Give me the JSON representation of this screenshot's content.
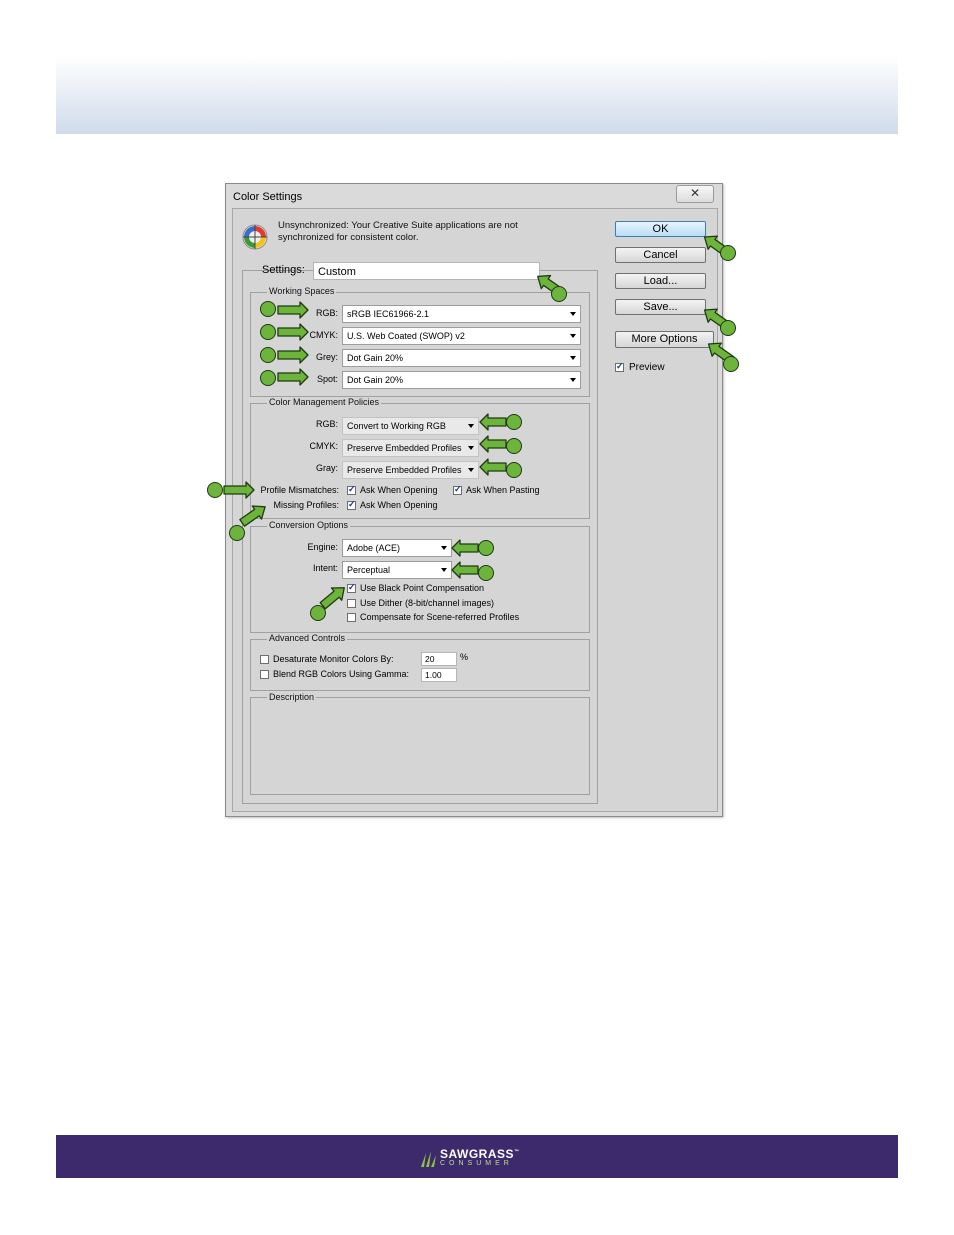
{
  "dialog": {
    "title": "Color Settings",
    "close_glyph": "✕",
    "sync_message": "Unsynchronized: Your Creative Suite applications are not synchronized for consistent color.",
    "settings_label": "Settings:",
    "settings_value": "Custom"
  },
  "working_spaces": {
    "title": "Working Spaces",
    "rgb_label": "RGB:",
    "rgb_value": "sRGB IEC61966-2.1",
    "cmyk_label": "CMYK:",
    "cmyk_value": "U.S. Web Coated (SWOP) v2",
    "grey_label": "Grey:",
    "grey_value": "Dot Gain 20%",
    "spot_label": "Spot:",
    "spot_value": "Dot Gain 20%"
  },
  "policies": {
    "title": "Color Management Policies",
    "rgb_label": "RGB:",
    "rgb_value": "Convert to Working RGB",
    "cmyk_label": "CMYK:",
    "cmyk_value": "Preserve Embedded Profiles",
    "gray_label": "Gray:",
    "gray_value": "Preserve Embedded Profiles",
    "mismatch_label": "Profile Mismatches:",
    "ask_opening": "Ask When Opening",
    "ask_pasting": "Ask When Pasting",
    "missing_label": "Missing Profiles:",
    "missing_ask_opening": "Ask When Opening"
  },
  "conversion": {
    "title": "Conversion Options",
    "engine_label": "Engine:",
    "engine_value": "Adobe (ACE)",
    "intent_label": "Intent:",
    "intent_value": "Perceptual",
    "black_point": "Use Black Point Compensation",
    "dither": "Use Dither (8-bit/channel images)",
    "scene": "Compensate for Scene-referred Profiles"
  },
  "advanced": {
    "title": "Advanced Controls",
    "desaturate": "Desaturate Monitor Colors By:",
    "desaturate_value": "20",
    "percent": "%",
    "blend": "Blend RGB Colors Using Gamma:",
    "blend_value": "1.00"
  },
  "description": {
    "title": "Description"
  },
  "buttons": {
    "ok": "OK",
    "cancel": "Cancel",
    "load": "Load...",
    "save": "Save...",
    "more_options": "More Options",
    "preview": "Preview"
  },
  "footer": {
    "brand": "SAWGRASS",
    "tm": "™",
    "sub": "CONSUMER"
  },
  "colors": {
    "callout": "#6db43d",
    "footer_bg": "#3c2a6c",
    "ok_button": "#b9ddf5"
  },
  "checkbox_states": {
    "ask_opening": true,
    "ask_pasting": true,
    "missing_ask_opening": true,
    "black_point": true,
    "dither": false,
    "scene": false,
    "desaturate": false,
    "blend": false,
    "preview": true
  }
}
